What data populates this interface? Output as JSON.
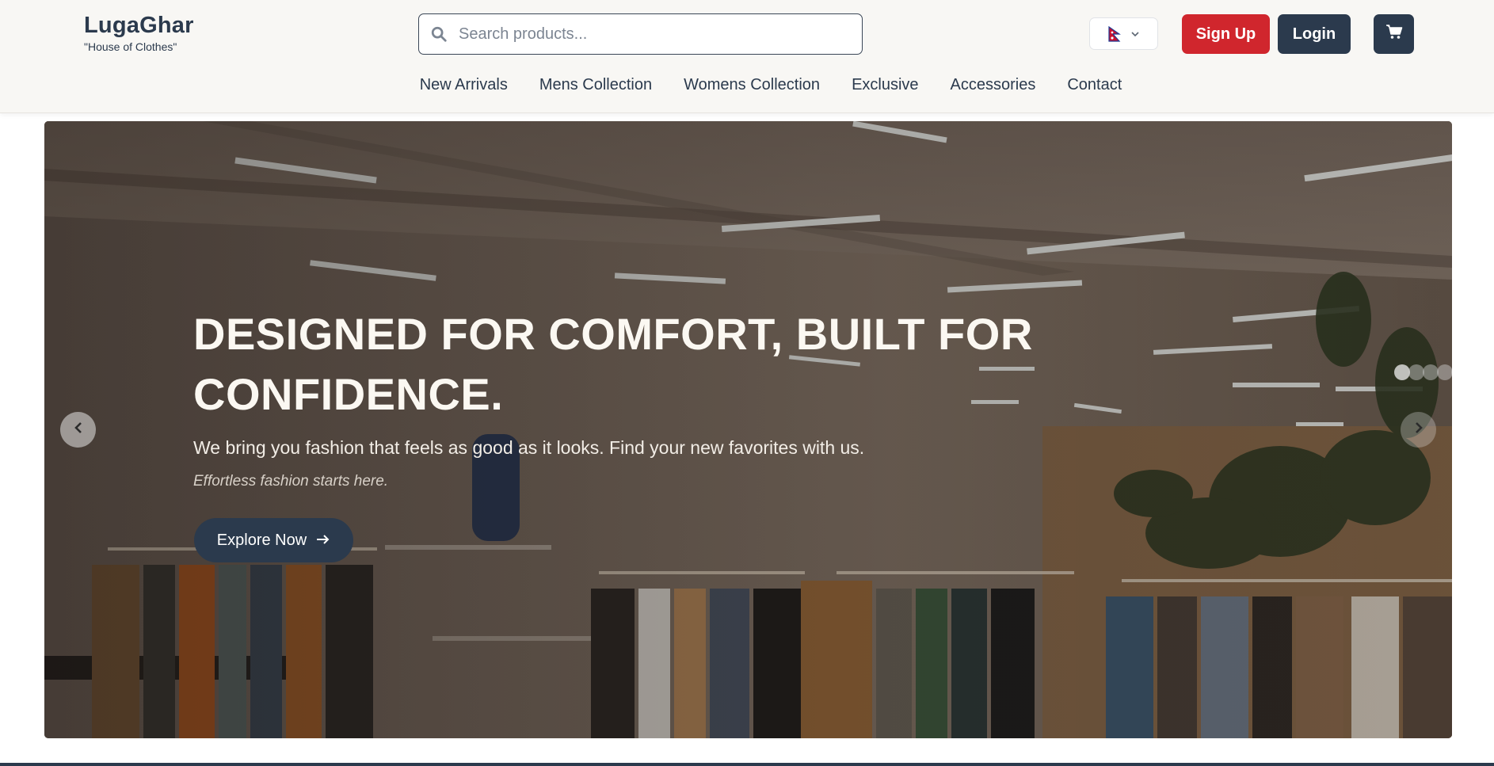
{
  "brand": {
    "name": "LugaGhar",
    "tagline": "\"House of Clothes\""
  },
  "search": {
    "placeholder": "Search products...",
    "value": ""
  },
  "header": {
    "language_flag": "nepal-flag-icon",
    "signup_label": "Sign Up",
    "login_label": "Login",
    "cart_icon": "cart-icon"
  },
  "nav": {
    "items": [
      {
        "label": "New Arrivals"
      },
      {
        "label": "Mens Collection"
      },
      {
        "label": "Womens Collection"
      },
      {
        "label": "Exclusive"
      },
      {
        "label": "Accessories"
      },
      {
        "label": "Contact"
      }
    ]
  },
  "hero": {
    "title": "DESIGNED FOR COMFORT, BUILT FOR CONFIDENCE.",
    "subtitle": "We bring you fashion that feels as good as it looks. Find your new favorites with us.",
    "tagline": "Effortless fashion starts here.",
    "cta_label": "Explore Now",
    "slides": 5,
    "active_slide": 1
  },
  "colors": {
    "primary": "#2b3a4d",
    "accent": "#d0262d",
    "header_bg": "#f8f7f4"
  }
}
